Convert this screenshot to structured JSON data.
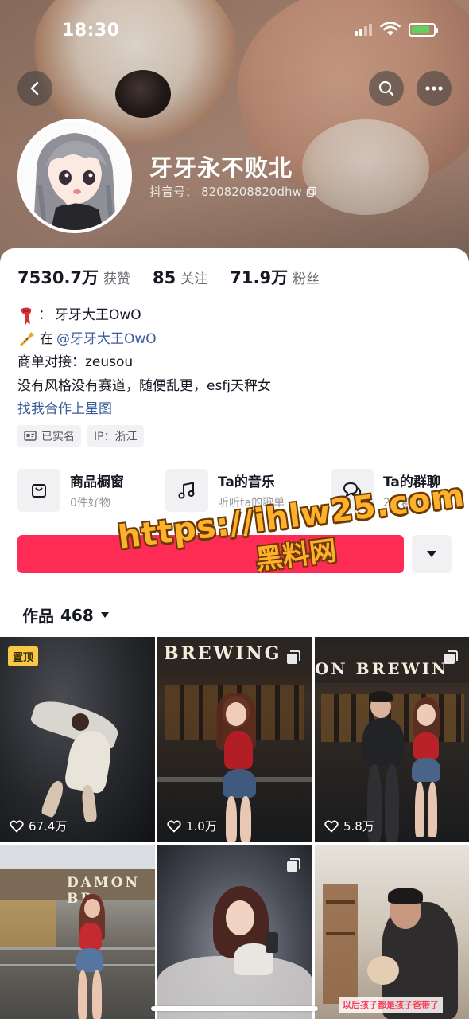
{
  "status_bar": {
    "time": "18:30"
  },
  "profile": {
    "display_name": "牙牙永不败北",
    "id_label": "抖音号：",
    "id_value": "8208208820dhw",
    "stats": [
      {
        "value": "7530.7万",
        "label": "获赞"
      },
      {
        "value": "85",
        "label": "关注"
      },
      {
        "value": "71.9万",
        "label": "粉丝"
      }
    ],
    "bio": {
      "line1_prefix": "：",
      "line1_text": "牙牙大王OwO",
      "line2_prefix": "在",
      "line2_mention": "@牙牙大王OwO",
      "line3": "商单对接：zeusou",
      "line4": "没有风格没有赛道，随便乱更，esfj天秤女",
      "link": "找我合作上星图"
    },
    "tags": [
      "已实名",
      "IP：浙江"
    ]
  },
  "features": [
    {
      "title": "商品橱窗",
      "subtitle": "0件好物",
      "icon": "shopping-bag-icon"
    },
    {
      "title": "Ta的音乐",
      "subtitle": "听听ta的歌单",
      "icon": "music-note-icon"
    },
    {
      "title": "Ta的群聊",
      "subtitle": "2个群聊",
      "icon": "chat-bubble-icon"
    }
  ],
  "actions": {
    "follow_label": ""
  },
  "watermark": {
    "url": "https://ihlw25.com",
    "site": "黑料网"
  },
  "works_tab": {
    "label": "作品",
    "count": "468"
  },
  "videos": [
    {
      "likes": "67.4万",
      "pinned": true,
      "pin_label": "置顶"
    },
    {
      "likes": "1.0万",
      "sign": "BREWING"
    },
    {
      "likes": "5.8万",
      "sign": "ON BREWIN"
    },
    {
      "likes": "",
      "sign": "DAMON BR"
    },
    {
      "likes": ""
    },
    {
      "likes": "",
      "caption": "以后孩子都是孩子爸带了"
    }
  ],
  "colors": {
    "accent": "#fe2c55",
    "link": "#3a5b9c",
    "pin": "#f7c748"
  }
}
